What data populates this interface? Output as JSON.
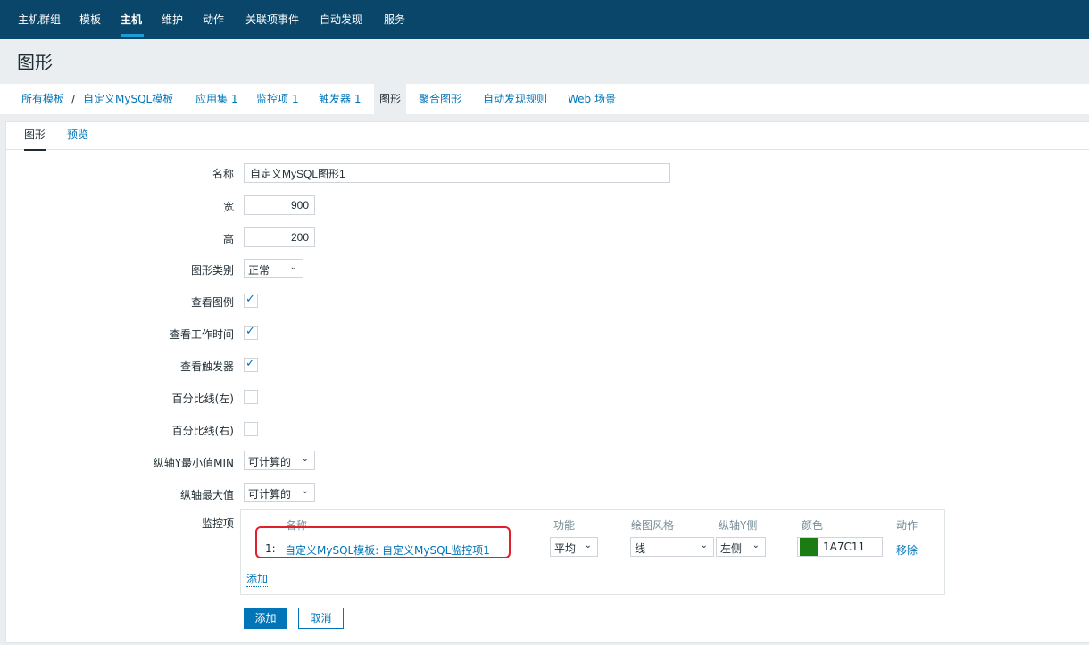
{
  "topnav": {
    "items": [
      "主机群组",
      "模板",
      "主机",
      "维护",
      "动作",
      "关联项事件",
      "自动发现",
      "服务"
    ]
  },
  "page": {
    "title": "图形"
  },
  "breadcrumb": {
    "all_templates": "所有模板",
    "separator": "/",
    "template": "自定义MySQL模板",
    "applications": "应用集 1",
    "items": "监控项 1",
    "triggers": "触发器 1",
    "graphs": "图形",
    "screens": "聚合图形",
    "discovery": "自动发现规则",
    "web": "Web 场景"
  },
  "tabs": {
    "graph": "图形",
    "preview": "预览"
  },
  "form": {
    "name_label": "名称",
    "name_value": "自定义MySQL图形1",
    "width_label": "宽",
    "width_value": "900",
    "height_label": "高",
    "height_value": "200",
    "graph_type_label": "图形类别",
    "graph_type_value": "正常",
    "show_legend_label": "查看图例",
    "show_worktime_label": "查看工作时间",
    "show_triggers_label": "查看触发器",
    "percentile_left_label": "百分比线(左)",
    "percentile_right_label": "百分比线(右)",
    "ymin_label": "纵轴Y最小值MIN",
    "ymin_value": "可计算的",
    "ymax_label": "纵轴最大值",
    "ymax_value": "可计算的",
    "items_label": "监控项"
  },
  "items_table": {
    "headers": {
      "name": "名称",
      "function": "功能",
      "draw_style": "绘图风格",
      "yaxis_side": "纵轴Y侧",
      "color": "颜色",
      "action": "动作"
    },
    "row": {
      "index": "1:",
      "name": "自定义MySQL模板: 自定义MySQL监控项1",
      "function": "平均",
      "draw_style": "线",
      "yaxis_side": "左侧",
      "color_value": "1A7C11",
      "color_hex": "#1a7c11",
      "remove": "移除"
    },
    "add": "添加"
  },
  "buttons": {
    "add": "添加",
    "cancel": "取消"
  },
  "icons": {
    "chevron": "chevron-down-icon",
    "check": "check-icon"
  },
  "colors": {
    "nav_bg": "#0a466a",
    "link": "#0275b8",
    "highlight": "#e0202a"
  }
}
